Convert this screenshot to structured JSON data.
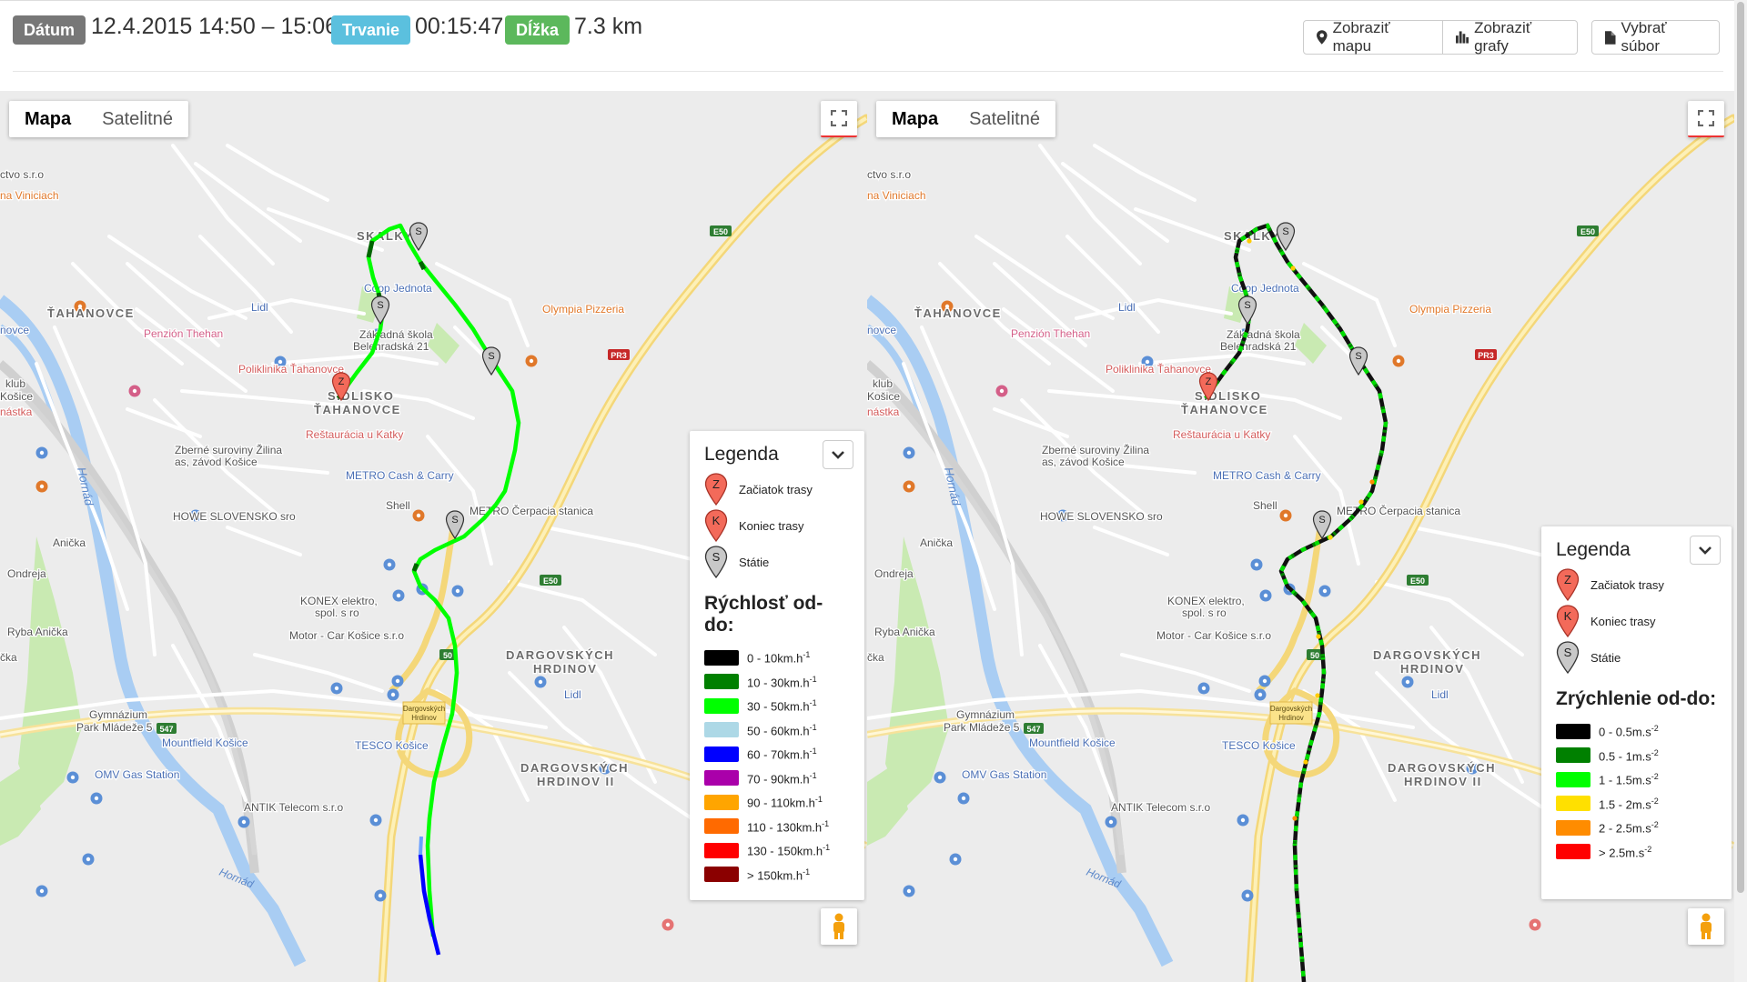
{
  "header": {
    "date_label": "Dátum",
    "date_value": "12.4.2015 14:50 – 15:06",
    "duration_label": "Trvanie",
    "duration_value": "00:15:47",
    "length_label": "Dĺžka",
    "length_value": "7.3 km",
    "show_map": "Zobraziť mapu",
    "show_charts": "Zobraziť grafy",
    "choose_file": "Vybrať súbor"
  },
  "colors": {
    "date_badge": "#777777",
    "duration_badge": "#5bc0de",
    "length_badge": "#5cb85c"
  },
  "map_types": {
    "map": "Mapa",
    "satellite": "Satelitné"
  },
  "places": {
    "skalky": "SKALKY",
    "tahanovce": "ŤAHANOVCE",
    "sidlisko1": "SÍDLISKO",
    "sidlisko2": "ŤAHANOVCE",
    "coop": "Coop Jednota",
    "lidl": "Lidl",
    "olympia": "Olympia Pizzeria",
    "penzion": "Penzión Thehan",
    "skola1": "Základná škola",
    "skola2": "Belehradská 21",
    "poliklinika": "Poliklinika Ťahanovce",
    "restauracia": "Reštaurácia u Katky",
    "zberne1": "Zberné suroviny Žilina",
    "zberne2": "as, závod Košice",
    "metro": "METRO Cash & Carry",
    "shell": "Shell",
    "metro_cerp": "METRO Čerpacia stanica",
    "howe": "HOWE SLOVENSKO sro",
    "anicka": "Anička",
    "ondreja": "Ondreja",
    "konex1": "KONEX elektro,",
    "konex2": "spol. s ro",
    "motor": "Motor - Car Košice s.r.o",
    "ryba": "Ryba Anička",
    "dargov1": "DARGOVSKÝCH",
    "dargov2": "HRDINOV",
    "dargov3": "DARGOVSKÝCH",
    "dargov4": "HRDINOV II",
    "gymnazium1": "Gymnázium",
    "gymnazium2": "Park Mládeže 5",
    "mountfield": "Mountfield Košice",
    "tesco": "TESCO Košice",
    "omv": "OMV Gas Station",
    "hornad": "Hornád",
    "ctvo": "ctvo s.r.o",
    "viniciach": "na Viniciach",
    "novce": "novce",
    "klub1": "klub",
    "klub2": "Košice",
    "nastka": "nástka",
    "cka": "čka",
    "antik": "ANTIK Telecom s.r.o",
    "dargov_sign1": "Dargovských",
    "dargov_sign2": "Hrdinov",
    "lidl2": "Lidl",
    "e50": "E50",
    "pr3": "PR3",
    "r50": "50",
    "r547": "547"
  },
  "legend_speed": {
    "title": "Legenda",
    "start": "Začiatok trasy",
    "end": "Koniec trasy",
    "stop": "Státie",
    "section": "Rýchlosť od-do:",
    "items": [
      {
        "label": "0 - 10km.h",
        "sup": "-1",
        "color": "#000000"
      },
      {
        "label": "10 - 30km.h",
        "sup": "-1",
        "color": "#008000"
      },
      {
        "label": "30 - 50km.h",
        "sup": "-1",
        "color": "#00ff00"
      },
      {
        "label": "50 - 60km.h",
        "sup": "-1",
        "color": "#add8e6"
      },
      {
        "label": "60 - 70km.h",
        "sup": "-1",
        "color": "#0000ff"
      },
      {
        "label": "70 - 90km.h",
        "sup": "-1",
        "color": "#aa00aa"
      },
      {
        "label": "90 - 110km.h",
        "sup": "-1",
        "color": "#ffa500"
      },
      {
        "label": "110 - 130km.h",
        "sup": "-1",
        "color": "#ff6a00"
      },
      {
        "label": "130 - 150km.h",
        "sup": "-1",
        "color": "#ff0000"
      },
      {
        "label": "> 150km.h",
        "sup": "-1",
        "color": "#8b0000"
      }
    ]
  },
  "legend_accel": {
    "title": "Legenda",
    "start": "Začiatok trasy",
    "end": "Koniec trasy",
    "stop": "Státie",
    "section": "Zrýchlenie od-do:",
    "items": [
      {
        "label": "0 - 0.5m.s",
        "sup": "-2",
        "color": "#000000"
      },
      {
        "label": "0.5 - 1m.s",
        "sup": "-2",
        "color": "#008000"
      },
      {
        "label": "1 - 1.5m.s",
        "sup": "-2",
        "color": "#00ff00"
      },
      {
        "label": "1.5 - 2m.s",
        "sup": "-2",
        "color": "#ffe000"
      },
      {
        "label": "2 - 2.5m.s",
        "sup": "-2",
        "color": "#ff8c00"
      },
      {
        "label": "> 2.5m.s",
        "sup": "-2",
        "color": "#ff0000"
      }
    ]
  },
  "markers": {
    "start": "Z",
    "end": "K",
    "stop": "S"
  }
}
